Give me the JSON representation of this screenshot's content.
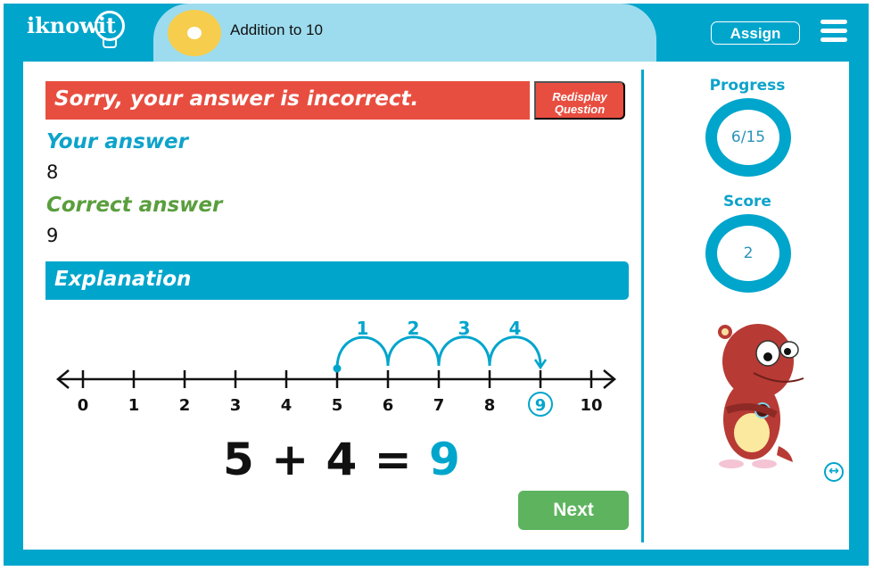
{
  "header": {
    "logo": "iknowit",
    "title": "Addition to 10",
    "assign_label": "Assign"
  },
  "feedback": {
    "message": "Sorry, your answer is incorrect.",
    "redisplay_line1": "Redisplay",
    "redisplay_line2": "Question",
    "your_answer_label": "Your answer",
    "your_answer_value": "8",
    "correct_answer_label": "Correct answer",
    "correct_answer_value": "9",
    "explanation_label": "Explanation"
  },
  "number_line": {
    "ticks": [
      "0",
      "1",
      "2",
      "3",
      "4",
      "5",
      "6",
      "7",
      "8",
      "9",
      "10"
    ],
    "start": 5,
    "hop_labels": [
      "1",
      "2",
      "3",
      "4"
    ],
    "highlight": "9"
  },
  "equation": {
    "left": "5 + 4 =",
    "answer": "9"
  },
  "next_label": "Next",
  "sidebar": {
    "progress_label": "Progress",
    "progress_value": "6/15",
    "score_label": "Score",
    "score_value": "2"
  },
  "colors": {
    "brand": "#00a5cc",
    "error": "#e84e40",
    "correct": "#5a9e3e",
    "next": "#5db35e"
  }
}
